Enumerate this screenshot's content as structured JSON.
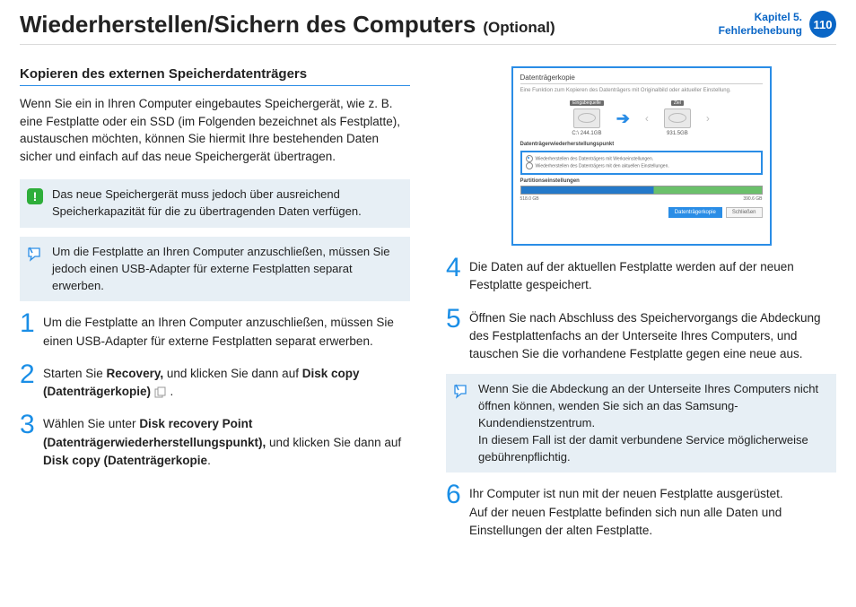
{
  "header": {
    "title": "Wiederherstellen/Sichern des Computers",
    "optional": "(Optional)",
    "chapter_line1": "Kapitel 5.",
    "chapter_line2": "Fehlerbehebung",
    "page_number": "110"
  },
  "left": {
    "section_title": "Kopieren des externen Speicherdatenträgers",
    "intro": "Wenn Sie ein in Ihren Computer eingebautes Speichergerät, wie z. B. eine Festplatte oder ein SSD (im Folgenden bezeichnet als Festplatte), austauschen möchten, können Sie hiermit Ihre bestehenden Daten sicher und einfach auf das neue Speichergerät übertragen.",
    "warning": "Das neue Speichergerät muss jedoch über ausreichend Speicherkapazität für die zu übertragenden Daten verfügen.",
    "note": "Um die Festplatte an Ihren Computer anzuschließen, müssen Sie jedoch einen USB-Adapter für externe Festplatten separat erwerben.",
    "step1": "Um die Festplatte an Ihren Computer anzuschließen, müssen Sie einen USB-Adapter für externe Festplatten separat erwerben.",
    "step2_a": "Starten Sie ",
    "step2_b": "Recovery,",
    "step2_c": " und klicken Sie dann auf ",
    "step2_d": "Disk copy (Datenträgerkopie)",
    "step2_e": " .",
    "step3_a": "Wählen Sie unter ",
    "step3_b": "Disk recovery Point (Datenträgerwiederherstellungspunkt),",
    "step3_c": " und klicken Sie dann auf ",
    "step3_d": "Disk copy (Datenträgerkopie",
    "step3_e": "."
  },
  "screenshot": {
    "window_title": "Datenträgerkopie",
    "subtitle": "Eine Funktion zum Kopieren des Datenträgers mit Originalbild oder aktueller Einstellung.",
    "src_top": "Eingabequelle",
    "dst_top": "Ziel",
    "src_label": "C:\\ 244.1GB",
    "dst_label": "931.5GB",
    "recovery_heading": "Datenträgerwiederherstellungspunkt",
    "opt1": "Wiederherstellen des Datenträgers mit Werkseinstellungen.",
    "opt2": "Wiederherstellen des Datenträgers mit den aktuellen Einstellungen.",
    "partition_heading": "Partitionseinstellungen",
    "bar_left": "518.0 GB",
    "bar_right": "390.6 GB",
    "btn_primary": "Datenträgerkopie",
    "btn_secondary": "Schließen"
  },
  "right": {
    "step4": "Die Daten auf der aktuellen Festplatte werden auf der neuen Festplatte gespeichert.",
    "step5": "Öffnen Sie nach Abschluss des Speichervorgangs die Abdeckung des Festplattenfachs an der Unterseite Ihres Computers, und tauschen Sie die vorhandene Festplatte gegen eine neue aus.",
    "note_a": "Wenn Sie die Abdeckung an der Unterseite Ihres Computers nicht öffnen können, wenden Sie sich an das Samsung-Kundendienstzentrum.",
    "note_b": "In diesem Fall ist der damit verbundene Service möglicherweise gebührenpflichtig.",
    "step6_a": "Ihr Computer ist nun mit der neuen Festplatte ausgerüstet.",
    "step6_b": "Auf der neuen Festplatte befinden sich nun alle Daten und Einstellungen der alten Festplatte."
  },
  "nums": {
    "n1": "1",
    "n2": "2",
    "n3": "3",
    "n4": "4",
    "n5": "5",
    "n6": "6"
  }
}
